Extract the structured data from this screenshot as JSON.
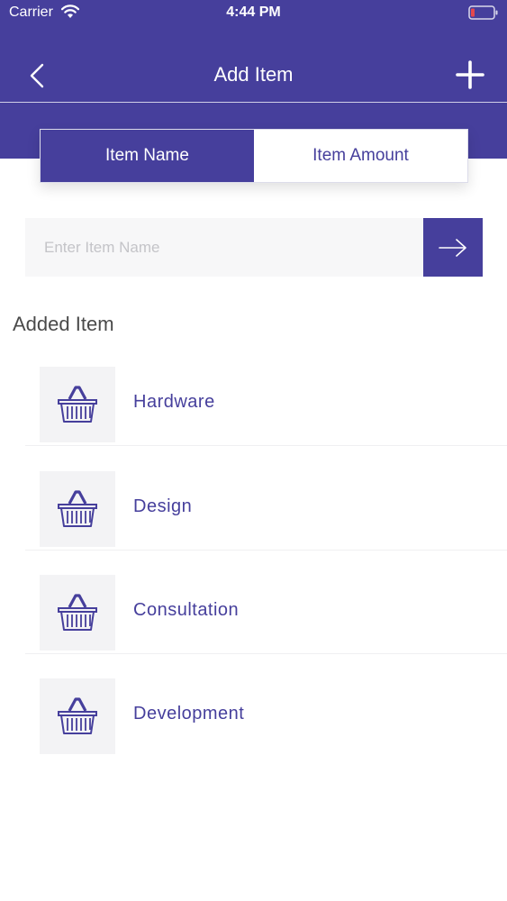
{
  "status_bar": {
    "carrier": "Carrier",
    "time": "4:44 PM"
  },
  "nav": {
    "title": "Add Item",
    "back_icon": "chevron-left-icon",
    "add_icon": "plus-icon"
  },
  "segments": [
    {
      "label": "Item Name",
      "active": true
    },
    {
      "label": "Item Amount",
      "active": false
    }
  ],
  "input": {
    "placeholder": "Enter Item Name",
    "value": ""
  },
  "section": {
    "title": "Added Item"
  },
  "items": [
    {
      "label": "Hardware",
      "icon": "basket-icon"
    },
    {
      "label": "Design",
      "icon": "basket-icon"
    },
    {
      "label": "Consultation",
      "icon": "basket-icon"
    },
    {
      "label": "Development",
      "icon": "basket-icon"
    }
  ],
  "colors": {
    "primary": "#463f9c",
    "text": "#4a4a4a",
    "thumb_bg": "#f3f3f5",
    "battery_low": "#e5484d"
  }
}
